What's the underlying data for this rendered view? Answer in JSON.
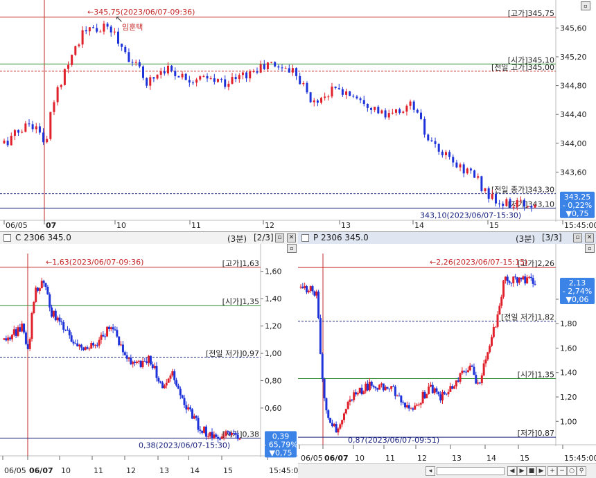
{
  "colors": {
    "up": "#e0202a",
    "down": "#1d32d8",
    "high_line": "#c62828",
    "open_line": "#2a8a2a",
    "low_line": "#1a237e",
    "prev_line": "#1d32d8",
    "axis_text": "#222222",
    "badge": "#3b83e6"
  },
  "chart_data": [
    {
      "id": "main",
      "type": "candlestick",
      "ylim": [
        342.95,
        345.95
      ],
      "yticks": [
        "345,60",
        "345,20",
        "344,80",
        "344,40",
        "344,00",
        "343,60"
      ],
      "ytick_values": [
        345.6,
        345.2,
        344.8,
        344.4,
        344.0,
        343.6
      ],
      "xticks": [
        "06/05",
        "07",
        "10",
        "11",
        "12",
        "13",
        "14",
        "15",
        "15:45:00"
      ],
      "hlines": [
        {
          "label": "[고가]345,75",
          "value": 345.75,
          "style": "high"
        },
        {
          "label": "[시가]345,10",
          "value": 345.1,
          "style": "open"
        },
        {
          "label": "[전일 고가]345,00",
          "value": 345.0,
          "style": "prev"
        },
        {
          "label": "[전일 종가]343,30",
          "value": 343.3,
          "style": "prevdash"
        },
        {
          "label": "[저가]343,10",
          "value": 343.1,
          "style": "low"
        }
      ],
      "high_note": "345,75(2023/06/07-09:36)",
      "low_note": "343,10(2023/06/07-15:30)",
      "cursor_label": "임훈택",
      "badge": [
        "343,25",
        "- 0,22%",
        "▼0,75"
      ],
      "waypoints": [
        [
          0,
          344.0
        ],
        [
          0.05,
          344.3
        ],
        [
          0.08,
          344.0
        ],
        [
          0.09,
          344.5
        ],
        [
          0.12,
          345.15
        ],
        [
          0.15,
          345.55
        ],
        [
          0.2,
          345.6
        ],
        [
          0.23,
          345.25
        ],
        [
          0.27,
          344.85
        ],
        [
          0.3,
          345.05
        ],
        [
          0.35,
          344.9
        ],
        [
          0.42,
          344.85
        ],
        [
          0.47,
          345.0
        ],
        [
          0.5,
          345.1
        ],
        [
          0.55,
          345.0
        ],
        [
          0.58,
          344.55
        ],
        [
          0.62,
          344.75
        ],
        [
          0.67,
          344.65
        ],
        [
          0.72,
          344.35
        ],
        [
          0.77,
          344.55
        ],
        [
          0.8,
          344.0
        ],
        [
          0.85,
          343.7
        ],
        [
          0.88,
          343.6
        ],
        [
          0.91,
          343.3
        ],
        [
          0.93,
          343.15
        ]
      ]
    },
    {
      "id": "call",
      "type": "candlestick",
      "title": "C 2306 345.0",
      "timeframe": "(3분)",
      "page": "[2/3]",
      "ylim": [
        0.26,
        1.7
      ],
      "yticks": [
        "1,60",
        "1,40",
        "1,20",
        "1,00",
        "0,80",
        "0,60"
      ],
      "ytick_values": [
        1.6,
        1.4,
        1.2,
        1.0,
        0.8,
        0.6
      ],
      "xticks": [
        "06/05",
        "06/07",
        "10",
        "11",
        "12",
        "13",
        "14",
        "15",
        "15:45:00"
      ],
      "hlines": [
        {
          "label": "[고가]1,63",
          "value": 1.63,
          "style": "high"
        },
        {
          "label": "[시가]1,35",
          "value": 1.35,
          "style": "open"
        },
        {
          "label": "[전일 저가]0,97",
          "value": 0.97,
          "style": "prev"
        },
        {
          "label": "[저가]0,38",
          "value": 0.38,
          "style": "low"
        }
      ],
      "high_note": "1,63(2023/06/07-09:36)",
      "low_note": "0,38(2023/06/07-15:30)",
      "badge": [
        "0,39",
        "- 65,79%",
        "▼0,75"
      ],
      "waypoints": [
        [
          0,
          1.1
        ],
        [
          0.08,
          1.2
        ],
        [
          0.1,
          1.0
        ],
        [
          0.13,
          1.45
        ],
        [
          0.17,
          1.55
        ],
        [
          0.2,
          1.3
        ],
        [
          0.25,
          1.2
        ],
        [
          0.3,
          1.05
        ],
        [
          0.38,
          1.05
        ],
        [
          0.45,
          1.2
        ],
        [
          0.5,
          1.05
        ],
        [
          0.55,
          0.92
        ],
        [
          0.62,
          0.95
        ],
        [
          0.67,
          0.75
        ],
        [
          0.72,
          0.85
        ],
        [
          0.77,
          0.62
        ],
        [
          0.83,
          0.45
        ],
        [
          0.88,
          0.4
        ]
      ]
    },
    {
      "id": "put",
      "type": "candlestick",
      "title": "P 2306 345.0",
      "timeframe": "(3분)",
      "page": "[3/3]",
      "ylim": [
        0.82,
        2.34
      ],
      "yticks": [
        "2,00",
        "1,80",
        "1,60",
        "1,40",
        "1,20",
        "1,00"
      ],
      "ytick_values": [
        2.0,
        1.8,
        1.6,
        1.4,
        1.2,
        1.0
      ],
      "xticks": [
        "06/05",
        "06/07",
        "10",
        "11",
        "12",
        "13",
        "14",
        "15",
        "15:45:00"
      ],
      "hlines": [
        {
          "label": "[고가]2,26",
          "value": 2.26,
          "style": "high"
        },
        {
          "label": "[전일 저가]1,82",
          "value": 1.82,
          "style": "prev"
        },
        {
          "label": "[시가]1,35",
          "value": 1.35,
          "style": "open"
        },
        {
          "label": "[저가]0,87",
          "value": 0.87,
          "style": "low"
        }
      ],
      "high_note": "2,26(2023/06/07-15:15)",
      "low_note": "0,87(2023/06/07-09:51)",
      "badge": [
        "2,13",
        "- 2,74%",
        "▼0,06"
      ],
      "waypoints": [
        [
          0,
          2.1
        ],
        [
          0.07,
          2.05
        ],
        [
          0.09,
          1.35
        ],
        [
          0.12,
          1.0
        ],
        [
          0.16,
          0.92
        ],
        [
          0.2,
          1.15
        ],
        [
          0.25,
          1.25
        ],
        [
          0.3,
          1.3
        ],
        [
          0.4,
          1.25
        ],
        [
          0.45,
          1.1
        ],
        [
          0.5,
          1.15
        ],
        [
          0.55,
          1.28
        ],
        [
          0.6,
          1.2
        ],
        [
          0.65,
          1.3
        ],
        [
          0.72,
          1.45
        ],
        [
          0.76,
          1.3
        ],
        [
          0.8,
          1.6
        ],
        [
          0.84,
          1.85
        ],
        [
          0.87,
          2.2
        ],
        [
          0.9,
          2.15
        ]
      ]
    }
  ],
  "scroll_icons": [
    "◀",
    "▶",
    "■",
    "▶",
    "⊕",
    "⊖",
    "⊕",
    "🔍"
  ]
}
